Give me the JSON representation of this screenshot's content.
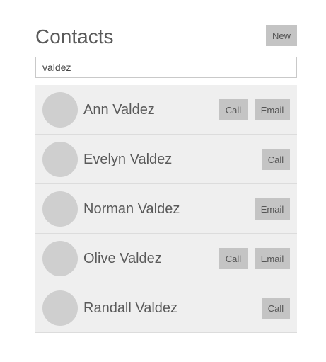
{
  "header": {
    "title": "Contacts",
    "new_label": "New"
  },
  "search": {
    "value": "valdez"
  },
  "contacts": [
    {
      "name": "Ann Valdez",
      "actions": [
        "Call",
        "Email"
      ]
    },
    {
      "name": "Evelyn Valdez",
      "actions": [
        "Call"
      ]
    },
    {
      "name": "Norman Valdez",
      "actions": [
        "Email"
      ]
    },
    {
      "name": "Olive Valdez",
      "actions": [
        "Call",
        "Email"
      ]
    },
    {
      "name": "Randall Valdez",
      "actions": [
        "Call"
      ]
    }
  ],
  "colors": {
    "row_background": "#efefef",
    "button_background": "#c4c4c4",
    "avatar": "#cfcfcf",
    "text": "#5a5a5a"
  }
}
